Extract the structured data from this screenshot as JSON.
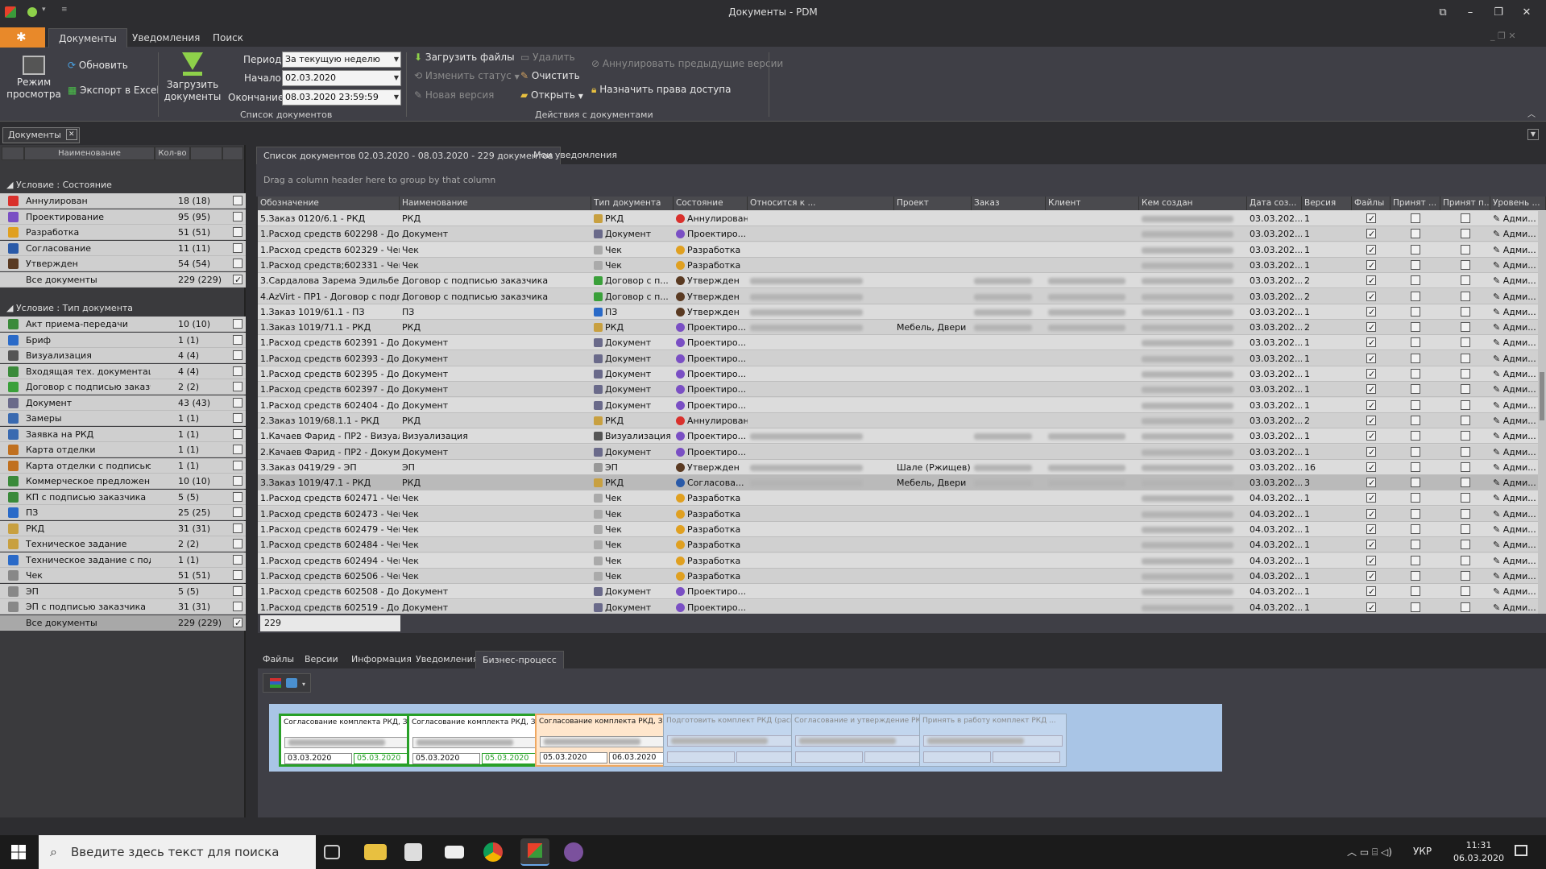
{
  "window": {
    "title": "Документы - PDM",
    "minimize": "–",
    "restore": "❐",
    "close": "✕"
  },
  "ribbon_tabs": [
    "Документы",
    "Уведомления",
    "Поиск"
  ],
  "ribbon": {
    "view_mode": "Режим просмотра",
    "refresh": "Обновить",
    "export_excel": "Экспорт в Excel",
    "upload_docs": "Загрузить документы",
    "period_label": "Период",
    "period_value": "За текущую неделю",
    "start_label": "Начало",
    "start_value": "02.03.2020",
    "end_label": "Окончание",
    "end_value": "08.03.2020 23:59:59",
    "group1": "Список документов",
    "upload_files": "Загрузить файлы",
    "change_status": "Изменить статус",
    "new_version": "Новая версия",
    "delete": "Удалить",
    "clear": "Очистить",
    "open": "Открыть",
    "annul_prev": "Аннулировать предыдущие версии",
    "assign_rights": "Назначить права доступа",
    "group2": "Действия с документами"
  },
  "doc_tab": "Документы",
  "left": {
    "col_name": "Наименование",
    "col_count": "Кол-во",
    "group_state": "Условие : Состояние",
    "states": [
      {
        "name": "Аннулирован",
        "count": "18 (18)",
        "checked": false,
        "color": "#d9302c"
      },
      {
        "name": "Проектирование",
        "count": "95 (95)",
        "checked": false,
        "color": "#7a4fc4"
      },
      {
        "name": "Разработка",
        "count": "51 (51)",
        "checked": false,
        "color": "#e0a020"
      },
      {
        "name": "Согласование",
        "count": "11 (11)",
        "checked": false,
        "color": "#2a5aa8"
      },
      {
        "name": "Утвержден",
        "count": "54 (54)",
        "checked": false,
        "color": "#5a3a22"
      },
      {
        "name": "Все документы",
        "count": "229 (229)",
        "checked": true,
        "color": ""
      }
    ],
    "group_type": "Условие : Тип документа",
    "types": [
      {
        "name": "Акт приема-передачи",
        "count": "10 (10)",
        "checked": false,
        "color": "#3a8a3a"
      },
      {
        "name": "Бриф",
        "count": "1 (1)",
        "checked": false,
        "color": "#2a6ac8"
      },
      {
        "name": "Визуализация",
        "count": "4 (4)",
        "checked": false,
        "color": "#555"
      },
      {
        "name": "Входящая тех. документация",
        "count": "4 (4)",
        "checked": false,
        "color": "#3a8a3a"
      },
      {
        "name": "Договор с подписью заказч...",
        "count": "2 (2)",
        "checked": false,
        "color": "#3aa03a"
      },
      {
        "name": "Документ",
        "count": "43 (43)",
        "checked": false,
        "color": "#6a6a8a"
      },
      {
        "name": "Замеры",
        "count": "1 (1)",
        "checked": false,
        "color": "#3a6ab0"
      },
      {
        "name": "Заявка на РКД",
        "count": "1 (1)",
        "checked": false,
        "color": "#3a6ab0"
      },
      {
        "name": "Карта отделки",
        "count": "1 (1)",
        "checked": false,
        "color": "#c07020"
      },
      {
        "name": "Карта отделки с подписью ...",
        "count": "1 (1)",
        "checked": false,
        "color": "#c07020"
      },
      {
        "name": "Коммерческое предложение",
        "count": "10 (10)",
        "checked": false,
        "color": "#3a8a3a"
      },
      {
        "name": "КП с подписью заказчика",
        "count": "5 (5)",
        "checked": false,
        "color": "#3a8a3a"
      },
      {
        "name": "ПЗ",
        "count": "25 (25)",
        "checked": false,
        "color": "#2a6ac8"
      },
      {
        "name": "РКД",
        "count": "31 (31)",
        "checked": false,
        "color": "#c8a040"
      },
      {
        "name": "Техническое задание",
        "count": "2 (2)",
        "checked": false,
        "color": "#c8a040"
      },
      {
        "name": "Техническое задание с под...",
        "count": "1 (1)",
        "checked": false,
        "color": "#2a6ac8"
      },
      {
        "name": "Чек",
        "count": "51 (51)",
        "checked": false,
        "color": "#888"
      },
      {
        "name": "ЭП",
        "count": "5 (5)",
        "checked": false,
        "color": "#888"
      },
      {
        "name": "ЭП с подписью заказчика",
        "count": "31 (31)",
        "checked": false,
        "color": "#888"
      },
      {
        "name": "Все документы",
        "count": "229 (229)",
        "checked": true,
        "color": ""
      }
    ]
  },
  "main_tabs": [
    "Список документов 02.03.2020 - 08.03.2020 - 229 документов",
    "Мои уведомления"
  ],
  "group_hint": "Drag a column header here to group by that column",
  "grid": {
    "columns": [
      "Обозначение",
      "Наименование",
      "Тип документа",
      "Состояние",
      "Относится к ...",
      "Проект",
      "Заказ",
      "Клиент",
      "Кем создан",
      "Дата соз...",
      "Версия",
      "Файлы",
      "Принят ...",
      "Принят п...",
      "Уровень ..."
    ],
    "rows": [
      [
        "5.Заказ 0120/6.1 - РКД",
        "РКД",
        "РКД",
        "Аннулирован",
        "",
        "",
        "",
        "",
        "b",
        "03.03.202...",
        "1",
        "",
        ""
      ],
      [
        "1.Расход средств 602298 - Док...",
        "Документ",
        "Документ",
        "Проектиро...",
        "",
        "",
        "",
        "",
        "b",
        "03.03.202...",
        "1",
        "",
        ""
      ],
      [
        "1.Расход средств 602329 - Чек",
        "Чек",
        "Чек",
        "Разработка",
        "",
        "",
        "",
        "",
        "b",
        "03.03.202...",
        "1",
        "",
        ""
      ],
      [
        "1.Расход средств;602331 - Чек",
        "Чек",
        "Чек",
        "Разработка",
        "",
        "",
        "",
        "",
        "b",
        "03.03.202...",
        "1",
        "",
        ""
      ],
      [
        "3.Сардалова Зарема Эдильбек...",
        "Договор с подписью заказчика",
        "Договор с п...",
        "Утвержден",
        "b",
        "",
        "b",
        "b",
        "b",
        "03.03.202...",
        "2",
        "",
        ""
      ],
      [
        "4.AzVirt - ПР1 - Договор с подпи...",
        "Договор с подписью заказчика",
        "Договор с п...",
        "Утвержден",
        "b",
        "",
        "b",
        "b",
        "b",
        "03.03.202...",
        "2",
        "",
        ""
      ],
      [
        "1.Заказ 1019/61.1 - ПЗ",
        "ПЗ",
        "ПЗ",
        "Утвержден",
        "b",
        "",
        "b",
        "b",
        "b",
        "03.03.202...",
        "1",
        "",
        ""
      ],
      [
        "1.Заказ 1019/71.1 - РКД",
        "РКД",
        "РКД",
        "Проектиро...",
        "b",
        "Мебель, Двери",
        "b",
        "b",
        "b",
        "03.03.202...",
        "2",
        "",
        ""
      ],
      [
        "1.Расход средств 602391 - Док...",
        "Документ",
        "Документ",
        "Проектиро...",
        "",
        "",
        "",
        "",
        "b",
        "03.03.202...",
        "1",
        "",
        ""
      ],
      [
        "1.Расход средств 602393 - Док...",
        "Документ",
        "Документ",
        "Проектиро...",
        "",
        "",
        "",
        "",
        "b",
        "03.03.202...",
        "1",
        "",
        ""
      ],
      [
        "1.Расход средств 602395 - Док...",
        "Документ",
        "Документ",
        "Проектиро...",
        "",
        "",
        "",
        "",
        "b",
        "03.03.202...",
        "1",
        "",
        ""
      ],
      [
        "1.Расход средств 602397 - Док...",
        "Документ",
        "Документ",
        "Проектиро...",
        "",
        "",
        "",
        "",
        "b",
        "03.03.202...",
        "1",
        "",
        ""
      ],
      [
        "1.Расход средств 602404 - Док...",
        "Документ",
        "Документ",
        "Проектиро...",
        "",
        "",
        "",
        "",
        "b",
        "03.03.202...",
        "1",
        "",
        ""
      ],
      [
        "2.Заказ 1019/68.1.1 - РКД",
        "РКД",
        "РКД",
        "Аннулирован",
        "",
        "",
        "",
        "",
        "b",
        "03.03.202...",
        "2",
        "",
        ""
      ],
      [
        "1.Качаев Фарид - ПР2 - Визуали...",
        "Визуализация",
        "Визуализация",
        "Проектиро...",
        "b",
        "",
        "b",
        "b",
        "b",
        "03.03.202...",
        "1",
        "",
        ""
      ],
      [
        "2.Качаев Фарид - ПР2 - Документ",
        "Документ",
        "Документ",
        "Проектиро...",
        "",
        "",
        "",
        "",
        "b",
        "03.03.202...",
        "1",
        "",
        ""
      ],
      [
        "3.Заказ 0419/29 - ЭП",
        "ЭП",
        "ЭП",
        "Утвержден",
        "b",
        "Шале (Ржищев)",
        "b",
        "b",
        "b",
        "03.03.202...",
        "16",
        "",
        ""
      ],
      [
        "3.Заказ 1019/47.1 - РКД",
        "РКД",
        "РКД",
        "Согласова...",
        "b",
        "Мебель, Двери",
        "b",
        "b",
        "b",
        "03.03.202...",
        "3",
        "",
        ""
      ],
      [
        "1.Расход средств 602471 - Чек",
        "Чек",
        "Чек",
        "Разработка",
        "",
        "",
        "",
        "",
        "b",
        "04.03.202...",
        "1",
        "",
        ""
      ],
      [
        "1.Расход средств 602473 - Чек",
        "Чек",
        "Чек",
        "Разработка",
        "",
        "",
        "",
        "",
        "b",
        "04.03.202...",
        "1",
        "",
        ""
      ],
      [
        "1.Расход средств 602479 - Чек",
        "Чек",
        "Чек",
        "Разработка",
        "",
        "",
        "",
        "",
        "b",
        "04.03.202...",
        "1",
        "",
        ""
      ],
      [
        "1.Расход средств 602484 - Чек",
        "Чек",
        "Чек",
        "Разработка",
        "",
        "",
        "",
        "",
        "b",
        "04.03.202...",
        "1",
        "",
        ""
      ],
      [
        "1.Расход средств 602494 - Чек",
        "Чек",
        "Чек",
        "Разработка",
        "",
        "",
        "",
        "",
        "b",
        "04.03.202...",
        "1",
        "",
        ""
      ],
      [
        "1.Расход средств 602506 - Чек",
        "Чек",
        "Чек",
        "Разработка",
        "",
        "",
        "",
        "",
        "b",
        "04.03.202...",
        "1",
        "",
        ""
      ],
      [
        "1.Расход средств 602508 - Док...",
        "Документ",
        "Документ",
        "Проектиро...",
        "",
        "",
        "",
        "",
        "b",
        "04.03.202...",
        "1",
        "",
        ""
      ],
      [
        "1.Расход средств 602519 - Док...",
        "Документ",
        "Документ",
        "Проектиро...",
        "",
        "",
        "",
        "",
        "b",
        "04.03.202...",
        "1",
        "",
        ""
      ]
    ],
    "level_text": "Адми..."
  },
  "footer_count": "229",
  "bottom_tabs": [
    "Файлы",
    "Версии",
    "Информация",
    "Уведомления",
    "Бизнес-процесс"
  ],
  "flow": [
    {
      "title": "Согласование комплекта РКД, З...",
      "d1": "03.03.2020",
      "d2": "05.03.2020",
      "state": "done"
    },
    {
      "title": "Согласование комплекта РКД, З...",
      "d1": "05.03.2020",
      "d2": "05.03.2020",
      "state": "done"
    },
    {
      "title": "Согласование комплекта РКД, З...",
      "d1": "05.03.2020",
      "d2": "06.03.2020",
      "state": "active"
    },
    {
      "title": "Подготовить комплект РКД (расп...",
      "d1": "",
      "d2": "",
      "state": "pending"
    },
    {
      "title": "Согласование и утверждение РКД...",
      "d1": "",
      "d2": "",
      "state": "pending"
    },
    {
      "title": "Принять в работу комплект РКД ...",
      "d1": "",
      "d2": "",
      "state": "pending"
    }
  ],
  "taskbar": {
    "search_placeholder": "Введите здесь текст для поиска",
    "lang": "УКР",
    "time": "11:31",
    "date": "06.03.2020"
  }
}
